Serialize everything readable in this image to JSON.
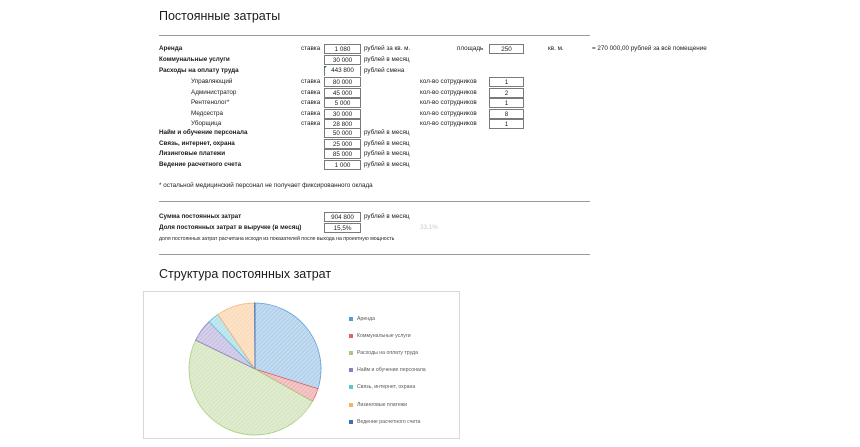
{
  "title": "Постоянные затраты",
  "rows": {
    "rent": {
      "label": "Аренда",
      "rate_label": "ставка",
      "value": "1 080",
      "unit": "рублей за кв. м.",
      "area_label": "площадь",
      "area_value": "250",
      "area_unit": "кв. м.",
      "total_text": "= 270 000,00 рублей за всё помещение"
    },
    "utilities": {
      "label": "Коммунальные услуги",
      "value": "30 000",
      "unit": "рублей в месяц"
    },
    "payroll": {
      "label": "Расходы на оплату труда",
      "value": "443 800",
      "unit": "рублей смена"
    },
    "staff": [
      {
        "role": "Управляющий",
        "rate_label": "ставка",
        "value": "80 000",
        "count_label": "кол-во сотрудников",
        "count": "1"
      },
      {
        "role": "Администратор",
        "rate_label": "ставка",
        "value": "45 000",
        "count_label": "кол-во сотрудников",
        "count": "2"
      },
      {
        "role": "Рентгенолог*",
        "rate_label": "ставка",
        "value": "5 000",
        "count_label": "кол-во сотрудников",
        "count": "1"
      },
      {
        "role": "Медсестра",
        "rate_label": "ставка",
        "value": "30 000",
        "count_label": "кол-во сотрудников",
        "count": "8"
      },
      {
        "role": "Уборщица",
        "rate_label": "ставка",
        "value": "28 800",
        "count_label": "кол-во сотрудников",
        "count": "1"
      }
    ],
    "hiring": {
      "label": "Найм и обучение персонала",
      "value": "50 000",
      "unit": "рублей в месяц"
    },
    "comms": {
      "label": "Связь, интернет, охрана",
      "value": "25 000",
      "unit": "рублей в месяц"
    },
    "leasing": {
      "label": "Лизинговые платежи",
      "value": "85 000",
      "unit": "рублей в месяц"
    },
    "account": {
      "label": "Ведение расчетного счета",
      "value": "1 000",
      "unit": "рублей в месяц"
    }
  },
  "footnote": "* остальной медицинский персонал не получает фиксированного оклада",
  "summary": {
    "sum_label": "Сумма постоянных затрат",
    "sum_value": "904 800",
    "sum_unit": "рублей в месяц",
    "share_label": "Доля постоянных затрат в выручке (в месяц)",
    "share_value": "15,5%",
    "share_faint": "33,1%",
    "share_note": "доля постоянных затрат расчитана исходя из показателей после выхода на проектную мощность"
  },
  "chart_title": "Структура постоянных затрат",
  "chart_data": {
    "type": "pie",
    "title": "",
    "unit": "рублей в месяц",
    "legend_position": "right",
    "categories": [
      "Аренда",
      "Коммунальные услуги",
      "Расходы на оплату труда",
      "Найм и обучение персонала",
      "Связь, интернет, охрана",
      "Лизинговые платежи",
      "Ведение расчетного счета"
    ],
    "values": [
      270000,
      30000,
      443800,
      50000,
      25000,
      85000,
      1000
    ],
    "colors": [
      "#5b9bd5",
      "#e06666",
      "#a9c97c",
      "#8e7cc3",
      "#62c2d6",
      "#f6b26b",
      "#3d6fb6"
    ]
  }
}
